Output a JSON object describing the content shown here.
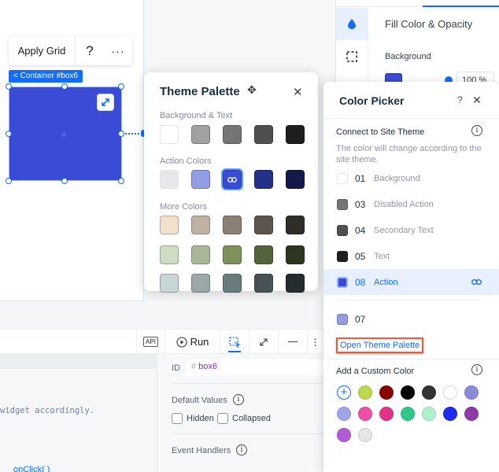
{
  "canvas": {
    "toolbar": {
      "apply_grid": "Apply Grid",
      "help": "?",
      "more": "···"
    },
    "container_tag": "< Container #box6",
    "box_color": "#3a4bd6"
  },
  "settings_panel": {
    "title": "Fill Color & Opacity",
    "background_label": "Background",
    "opacity_value": "100 %"
  },
  "theme_palette": {
    "title": "Theme Palette",
    "sections": [
      {
        "label": "Background & Text",
        "colors": [
          "#ffffff",
          "#a1a1a1",
          "#757575",
          "#4f4f4f",
          "#1e1e1e"
        ]
      },
      {
        "label": "Action Colors",
        "colors": [
          "#e6e7ea",
          "#939de3",
          "#3a4bd6",
          "#253188",
          "#15194a"
        ],
        "selected_index": 2
      },
      {
        "label": "More Colors",
        "rows": [
          [
            "#f3e0cc",
            "#c0b2a3",
            "#8c7f74",
            "#5e544e",
            "#2f2c2a"
          ],
          [
            "#d0dbc3",
            "#a9b798",
            "#7c915c",
            "#53633c",
            "#2c3623"
          ],
          [
            "#c8d5d7",
            "#9aa8aa",
            "#687c80",
            "#455356",
            "#242c2d"
          ]
        ]
      }
    ]
  },
  "color_picker": {
    "title": "Color Picker",
    "help": "?",
    "connect_heading": "Connect to Site Theme",
    "connect_desc": "The color will change according to the site theme.",
    "theme_items": [
      {
        "num": "01",
        "name": "Background",
        "color": "#ffffff"
      },
      {
        "num": "03",
        "name": "Disabled Action",
        "color": "#757575"
      },
      {
        "num": "04",
        "name": "Secondary Text",
        "color": "#4f4f4f"
      },
      {
        "num": "05",
        "name": "Text",
        "color": "#1e1e1e"
      },
      {
        "num": "08",
        "name": "Action",
        "color": "#3a4bd6",
        "active": true
      },
      {
        "num": "07",
        "name": "",
        "color": "#939de3"
      }
    ],
    "open_theme_palette": "Open Theme Palette",
    "custom_heading": "Add a Custom Color",
    "custom_colors": [
      "#bcd84e",
      "#8b0000",
      "#000000",
      "#333333",
      "#ffffff",
      "#8a8cd8",
      "#a0a4e8",
      "#ef4fa6",
      "#e4318a",
      "#30c78a",
      "#aeefcc",
      "#1f2bf5",
      "#8e3aa8",
      "#b25bd6",
      "#e6e6e6"
    ]
  },
  "bottom_toolbar": {
    "api": "API",
    "run": "Run"
  },
  "code": {
    "line": "widget accordingly."
  },
  "properties": {
    "id_label": "ID",
    "id_hash": "#",
    "id_value": "box6",
    "default_values": "Default Values",
    "hidden": "Hidden",
    "collapsed": "Collapsed",
    "event_handlers": "Event Handlers",
    "onclick": "onClick( )"
  }
}
